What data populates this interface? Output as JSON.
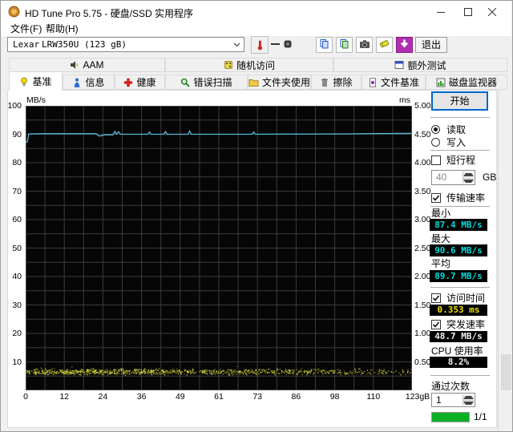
{
  "window": {
    "title": "HD Tune Pro 5.75 - 硬盘/SSD 实用程序"
  },
  "menu": {
    "items": [
      {
        "label": "文件(F)"
      },
      {
        "label": "帮助(H)"
      }
    ]
  },
  "toolbar": {
    "drive_select": {
      "vendor": "Lexar",
      "model": "LRW350U (123 gB)"
    },
    "temperature_dash": "—",
    "exit_label": "退出",
    "buttons": [
      {
        "icon": "copy-report"
      },
      {
        "icon": "copy-image"
      },
      {
        "icon": "screenshot"
      },
      {
        "icon": "save"
      },
      {
        "icon": "download"
      }
    ]
  },
  "tabs_row1": [
    {
      "label": "AAM",
      "icon": "speaker"
    },
    {
      "label": "随机访问",
      "icon": "dice"
    },
    {
      "label": "额外测试",
      "icon": "window"
    }
  ],
  "tabs_row2": [
    {
      "label": "基准",
      "icon": "bulb",
      "active": true
    },
    {
      "label": "信息",
      "icon": "info"
    },
    {
      "label": "健康",
      "icon": "health"
    },
    {
      "label": "错误扫描",
      "icon": "magnifier"
    },
    {
      "label": "文件夹使用",
      "icon": "folder"
    },
    {
      "label": "擦除",
      "icon": "trash"
    },
    {
      "label": "文件基准",
      "icon": "filebench"
    },
    {
      "label": "磁盘监视器",
      "icon": "diskmon"
    }
  ],
  "benchmark_panel": {
    "start_label": "开始",
    "read_label": "读取",
    "write_label": "写入",
    "read_selected": true,
    "short_stroke_label": "短行程",
    "short_stroke_checked": false,
    "capacity_value": "40",
    "capacity_unit": "GB",
    "transfer_rate_label": "传输速率",
    "transfer_rate_checked": true,
    "stats": [
      {
        "label": "最小",
        "value": "87.4 MB/s",
        "color": "#00dcdc"
      },
      {
        "label": "最大",
        "value": "90.6 MB/s",
        "color": "#00dcdc"
      },
      {
        "label": "平均",
        "value": "89.7 MB/s",
        "color": "#00dcdc"
      }
    ],
    "access_time": {
      "label": "访问时间",
      "checked": true,
      "value": "0.353 ms",
      "color": "#f0e000"
    },
    "burst_rate": {
      "label": "突发速率",
      "checked": true,
      "value": "48.7 MB/s",
      "color": "#f0f0f0"
    },
    "cpu_usage": {
      "label": "CPU 使用率",
      "value": "8.2%",
      "color": "#f0f0f0"
    },
    "pass_count": {
      "label": "通过次数",
      "value": "1"
    },
    "progress": {
      "fraction": 1,
      "label": "1/1",
      "color": "#09b025"
    }
  },
  "chart_data": {
    "type": "line+scatter",
    "x_axis": {
      "min": 0,
      "max": 123,
      "tick_labels": [
        "0",
        "12",
        "24",
        "36",
        "49",
        "61",
        "73",
        "86",
        "98",
        "110",
        "123gB"
      ],
      "minor_divisions": 20
    },
    "y_left": {
      "label": "MB/s",
      "min": 0,
      "max": 100,
      "major_step": 10,
      "minor_step": 5
    },
    "y_right": {
      "label": "ms",
      "tick_labels": [
        "5.00",
        "4.50",
        "4.00",
        "3.50",
        "3.00",
        "2.50",
        "2.00",
        "1.50",
        "1.00",
        "0.50"
      ]
    },
    "series": [
      {
        "name": "transfer_rate_mbps",
        "type": "line",
        "color": "#58b8dc",
        "points": [
          [
            0,
            87.2
          ],
          [
            0.5,
            87.3
          ],
          [
            1.0,
            90.1
          ],
          [
            5,
            90.2
          ],
          [
            22.5,
            90.2
          ],
          [
            23.2,
            89.4
          ],
          [
            24.2,
            89.5
          ],
          [
            25,
            89.8
          ],
          [
            27.9,
            89.8
          ],
          [
            28.4,
            91.0
          ],
          [
            28.9,
            90.0
          ],
          [
            29.6,
            90.9
          ],
          [
            30.2,
            90.0
          ],
          [
            33,
            90.0
          ],
          [
            38.9,
            90.0
          ],
          [
            39.4,
            90.8
          ],
          [
            39.9,
            90.0
          ],
          [
            44.0,
            90.0
          ],
          [
            44.5,
            90.9
          ],
          [
            45.0,
            90.0
          ],
          [
            51.7,
            90.0
          ],
          [
            52.2,
            91.1
          ],
          [
            52.7,
            90.0
          ],
          [
            60,
            90.0
          ],
          [
            72.1,
            90.0
          ],
          [
            72.6,
            90.8
          ],
          [
            73.1,
            90.0
          ],
          [
            85,
            90.05
          ],
          [
            100,
            90.1
          ],
          [
            112,
            90.25
          ],
          [
            123,
            90.3
          ]
        ]
      },
      {
        "name": "access_time_ms",
        "type": "scatter",
        "color": "#d6d63c",
        "band": {
          "ms_min": 0.25,
          "ms_max": 0.43,
          "ms_center": 0.353
        },
        "count": 1450,
        "seed": 7
      }
    ]
  }
}
